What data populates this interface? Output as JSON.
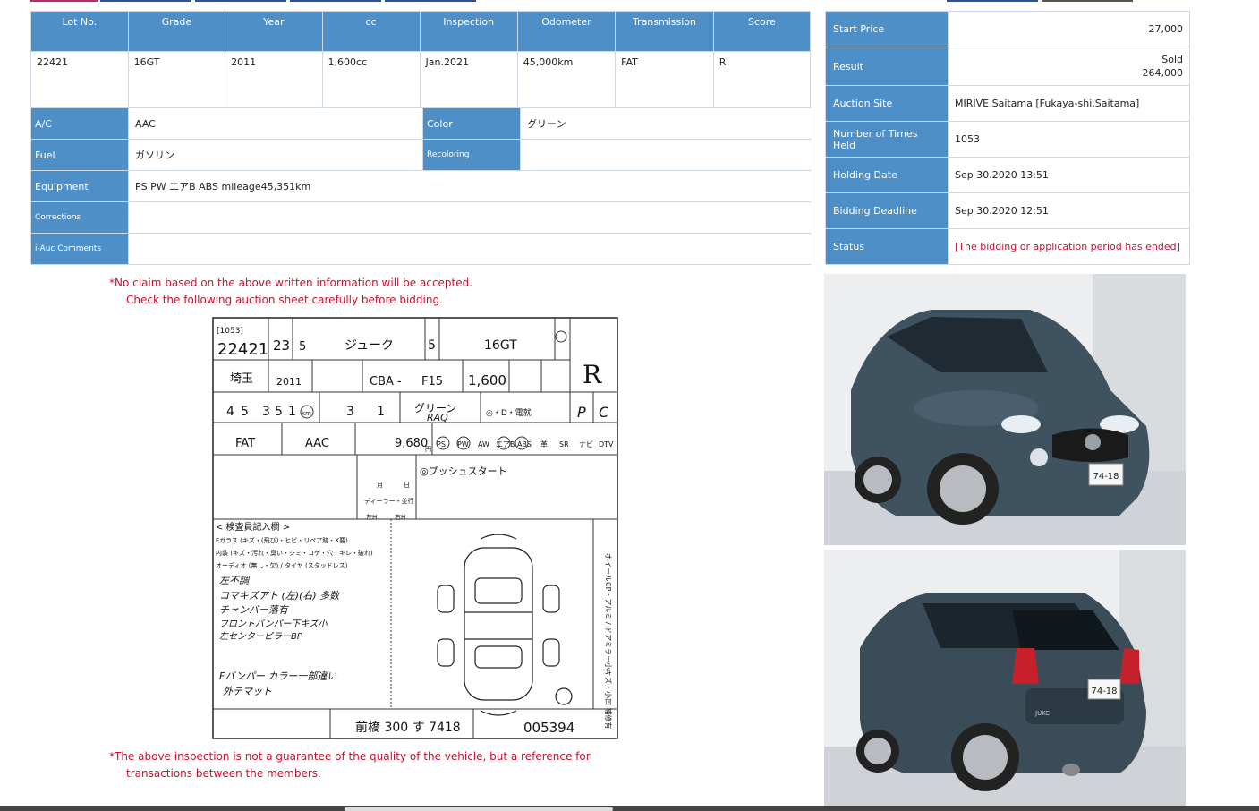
{
  "colors": {
    "header_blue": "#4f8fc8",
    "notice_red": "#c8102e",
    "status_red": "#c8102e",
    "nav_pink": "#c4256a",
    "nav_blue": "#2c4fa0"
  },
  "spec": {
    "headers": [
      "Lot No.",
      "Grade",
      "Year",
      "cc",
      "Inspection",
      "Odometer",
      "Transmission",
      "Score"
    ],
    "values": [
      "22421",
      "16GT",
      "2011",
      "1,600cc",
      "Jan.2021",
      "45,000km",
      "FAT",
      "R"
    ]
  },
  "equip": {
    "ac_label": "A/C",
    "ac_value": "AAC",
    "color_label": "Color",
    "color_value": "グリーン",
    "fuel_label": "Fuel",
    "fuel_value": "ガソリン",
    "recolor_label": "Recoloring",
    "recolor_value": "",
    "equipment_label": "Equipment",
    "equipment_value": "PS PW エアB ABS mileage45,351km",
    "corrections_label": "Corrections",
    "corrections_value": "",
    "comments_label": "i-Auc Comments",
    "comments_value": ""
  },
  "side": {
    "start_price_label": "Start Price",
    "start_price_value": "27,000",
    "result_label": "Result",
    "result_status": "Sold",
    "result_value": "264,000",
    "site_label": "Auction Site",
    "site_value": "MIRIVE Saitama [Fukaya-shi,Saitama]",
    "times_label": "Number of Times Held",
    "times_value": "1053",
    "holding_label": "Holding Date",
    "holding_value": "Sep 30.2020 13:51",
    "deadline_label": "Bidding Deadline",
    "deadline_value": "Sep 30.2020 12:51",
    "status_label": "Status",
    "status_value": "[The bidding or application period has ended]"
  },
  "notice_top": {
    "line1": "*No claim based on the above written information will be accepted.",
    "line2": "Check the following auction sheet carefully before bidding."
  },
  "notice_bottom": {
    "line1": "*The above inspection is not a guarantee of the quality of the vehicle, but a reference for",
    "line2": "transactions between the members."
  },
  "sheet": {
    "held": "[1053]",
    "lot": "22421",
    "reg_year": "23",
    "reg_month": "5",
    "model": "ジューク",
    "doors": "5",
    "grade": "16GT",
    "pref": "埼玉",
    "year": "2011",
    "type_code": "CBA -",
    "type": "F15",
    "cc": "1,600",
    "score": "R",
    "odo_digits": [
      "4",
      "5",
      "3",
      "5",
      "1"
    ],
    "odo_unit": "km",
    "seats": "3",
    "seats2": "1",
    "color": "グリーン",
    "color_code": "RAQ",
    "equip_mark": "◎・D・電就",
    "ext": "P",
    "int": "C",
    "shift": "FAT",
    "aircon": "AAC",
    "mileage": "9,680",
    "unit_yen": "円",
    "equip_tags": [
      "PS",
      "PW",
      "AW",
      "エアB",
      "ABS",
      "革",
      "SR",
      "ナビ",
      "DTV"
    ],
    "sales_point": "◎プッシュスタート",
    "inspector_header": "< 検査員記入欄 >",
    "memo_lines": [
      "Fガラス (キズ・(飛び)・ヒビ・リペア跡・X要)",
      "内装 (キズ・汚れ・臭い・シミ・コゲ・穴・キレ・破れ)",
      "オーディオ (無し・欠) / タイヤ (スタッドレス)"
    ],
    "hand_lines": [
      "左不調",
      "コマキズアト (左)(右) 多数",
      "チャンバー落有",
      "フロントバンパー下キズ小",
      "左センターピラーBP"
    ],
    "hand_lines2": [
      "Fバンパー カラー一部違い",
      "外テマット"
    ],
    "side_note": "ホイールCP・アルミ / ドアミラー小キズ・小凹 補修有",
    "plate": "前橋 300 す 7418",
    "doc_no": "005394",
    "small_boxes": [
      "月",
      "日",
      "ディーラー・並行",
      "左H",
      "右H"
    ]
  },
  "photos": {
    "front_plate": "74-18",
    "rear_plate": "74-18",
    "rear_badge": "JUKE"
  }
}
